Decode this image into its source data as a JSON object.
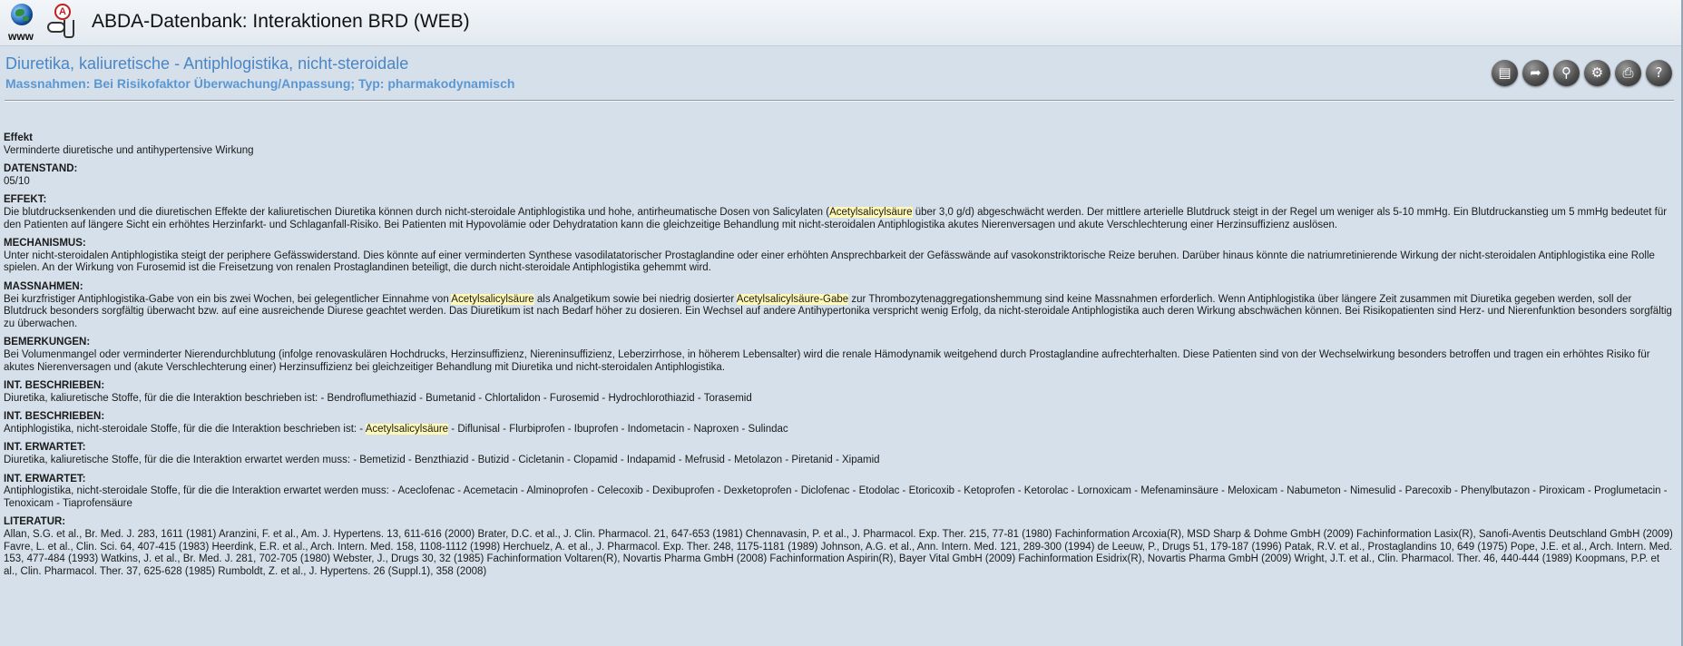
{
  "header": {
    "www_label": "www",
    "app_title": "ABDA-Datenbank: Interaktionen BRD (WEB)"
  },
  "document": {
    "title": "Diuretika, kaliuretische - Antiphlogistika, nicht-steroidale",
    "subtitle": "Massnahmen: Bei Risikofaktor Überwachung/Anpassung; Typ: pharmakodynamisch"
  },
  "toolbar": {
    "buttons": [
      {
        "name": "clipboard-icon",
        "glyph": "▤"
      },
      {
        "name": "export-icon",
        "glyph": "➦"
      },
      {
        "name": "search-icon",
        "glyph": "⚲"
      },
      {
        "name": "tree-icon",
        "glyph": "⚙"
      },
      {
        "name": "print-icon",
        "glyph": "⎙"
      },
      {
        "name": "help-icon",
        "glyph": "?"
      }
    ]
  },
  "sections": {
    "effekt_short": {
      "label": "Effekt",
      "text": "Verminderte diuretische und antihypertensive Wirkung"
    },
    "datenstand": {
      "label": "DATENSTAND:",
      "text": "05/10"
    },
    "effekt": {
      "label": "EFFEKT:",
      "text_a": "Die blutdrucksenkenden und die diuretischen Effekte der kaliuretischen Diuretika können durch nicht-steroidale Antiphlogistika und hohe, antirheumatische Dosen von Salicylaten (",
      "hl_1": "Acetylsalicylsäure",
      "text_b": " über 3,0 g/d) abgeschwächt werden. Der mittlere arterielle Blutdruck steigt in der Regel um weniger als 5-10 mmHg. Ein Blutdruckanstieg um 5 mmHg bedeutet für den Patienten auf längere Sicht ein erhöhtes Herzinfarkt- und Schlaganfall-Risiko. Bei Patienten mit Hypovolämie oder Dehydratation kann die gleichzeitige Behandlung mit nicht-steroidalen Antiphlogistika akutes Nierenversagen und akute Verschlechterung einer Herzinsuffizienz auslösen."
    },
    "mechanismus": {
      "label": "MECHANISMUS:",
      "text": "Unter nicht-steroidalen Antiphlogistika steigt der periphere Gefässwiderstand. Dies könnte auf einer verminderten Synthese vasodilatatorischer Prostaglandine oder einer erhöhten Ansprechbarkeit der Gefässwände auf vasokonstriktorische Reize beruhen. Darüber hinaus könnte die natriumretinierende Wirkung der nicht-steroidalen Antiphlogistika eine Rolle spielen. An der Wirkung von Furosemid ist die Freisetzung von renalen Prostaglandinen beteiligt, die durch nicht-steroidale Antiphlogistika gehemmt wird."
    },
    "massnahmen": {
      "label": "MASSNAHMEN:",
      "text_a": "Bei kurzfristiger Antiphlogistika-Gabe von ein bis zwei Wochen, bei gelegentlicher Einnahme von ",
      "hl_1": "Acetylsalicylsäure",
      "text_b": " als Analgetikum sowie bei niedrig dosierter ",
      "hl_2": "Acetylsalicylsäure-Gabe",
      "text_c": " zur Thrombozytenaggregationshemmung sind keine Massnahmen erforderlich. Wenn Antiphlogistika über längere Zeit zusammen mit Diuretika gegeben werden, soll der Blutdruck besonders sorgfältig überwacht bzw. auf eine ausreichende Diurese geachtet werden. Das Diuretikum ist nach Bedarf höher zu dosieren. Ein Wechsel auf andere Antihypertonika verspricht wenig Erfolg, da nicht-steroidale Antiphlogistika auch deren Wirkung abschwächen können. Bei Risikopatienten sind Herz- und Nierenfunktion besonders sorgfältig zu überwachen."
    },
    "bemerkungen": {
      "label": "BEMERKUNGEN:",
      "text": "Bei Volumenmangel oder verminderter Nierendurchblutung (infolge renovaskulären Hochdrucks, Herzinsuffizienz, Niereninsuffizienz, Leberzirrhose, in höherem Lebensalter) wird die renale Hämodynamik weitgehend durch Prostaglandine aufrechterhalten. Diese Patienten sind von der Wechselwirkung besonders betroffen und tragen ein erhöhtes Risiko für akutes Nierenversagen und (akute Verschlechterung einer) Herzinsuffizienz bei gleichzeitiger Behandlung mit Diuretika und nicht-steroidalen Antiphlogistika."
    },
    "int_beschrieben_1": {
      "label": "INT. BESCHRIEBEN:",
      "text": "Diuretika, kaliuretische Stoffe, für die die Interaktion beschrieben ist: - Bendroflumethiazid - Bumetanid - Chlortalidon - Furosemid - Hydrochlorothiazid - Torasemid"
    },
    "int_beschrieben_2": {
      "label": "INT. BESCHRIEBEN:",
      "text_a": "Antiphlogistika, nicht-steroidale Stoffe, für die die Interaktion beschrieben ist: - ",
      "hl_1": "Acetylsalicylsäure",
      "text_b": " - Diflunisal - Flurbiprofen - Ibuprofen - Indometacin - Naproxen - Sulindac"
    },
    "int_erwartet_1": {
      "label": "INT. ERWARTET:",
      "text": "Diuretika, kaliuretische Stoffe, für die die Interaktion erwartet werden muss: - Bemetizid - Benzthiazid - Butizid - Cicletanin - Clopamid - Indapamid - Mefrusid - Metolazon - Piretanid - Xipamid"
    },
    "int_erwartet_2": {
      "label": "INT. ERWARTET:",
      "text": "Antiphlogistika, nicht-steroidale Stoffe, für die die Interaktion erwartet werden muss: - Aceclofenac - Acemetacin - Alminoprofen - Celecoxib - Dexibuprofen - Dexketoprofen - Diclofenac - Etodolac - Etoricoxib - Ketoprofen - Ketorolac - Lornoxicam - Mefenaminsäure - Meloxicam - Nabumeton - Nimesulid - Parecoxib - Phenylbutazon - Piroxicam - Proglumetacin - Tenoxicam - Tiaprofensäure"
    },
    "literatur": {
      "label": "LITERATUR:",
      "text": "Allan, S.G. et al., Br. Med. J. 283, 1611 (1981) Aranzini, F. et al., Am. J. Hypertens. 13, 611-616 (2000) Brater, D.C. et al., J. Clin. Pharmacol. 21, 647-653 (1981) Chennavasin, P. et al., J. Pharmacol. Exp. Ther. 215, 77-81 (1980) Fachinformation Arcoxia(R), MSD Sharp & Dohme GmbH (2009) Fachinformation Lasix(R), Sanofi-Aventis Deutschland GmbH (2009) Favre, L. et al., Clin. Sci. 64, 407-415 (1983) Heerdink, E.R. et al., Arch. Intern. Med. 158, 1108-1112 (1998) Herchuelz, A. et al., J. Pharmacol. Exp. Ther. 248, 1175-1181 (1989) Johnson, A.G. et al., Ann. Intern. Med. 121, 289-300 (1994) de Leeuw, P., Drugs 51, 179-187 (1996) Patak, R.V. et al., Prostaglandins 10, 649 (1975) Pope, J.E. et al., Arch. Intern. Med. 153, 477-484 (1993) Watkins, J. et al., Br. Med. J. 281, 702-705 (1980) Webster, J., Drugs 30, 32 (1985) Fachinformation Voltaren(R), Novartis Pharma GmbH (2008) Fachinformation Aspirin(R), Bayer Vital GmbH (2009) Fachinformation Esidrix(R), Novartis Pharma GmbH (2009) Wright, J.T. et al., Clin. Pharmacol. Ther. 46, 440-444 (1989) Koopmans, P.P. et al., Clin. Pharmacol. Ther. 37, 625-628 (1985) Rumboldt, Z. et al., J. Hypertens. 26 (Suppl.1), 358 (2008)"
    }
  }
}
